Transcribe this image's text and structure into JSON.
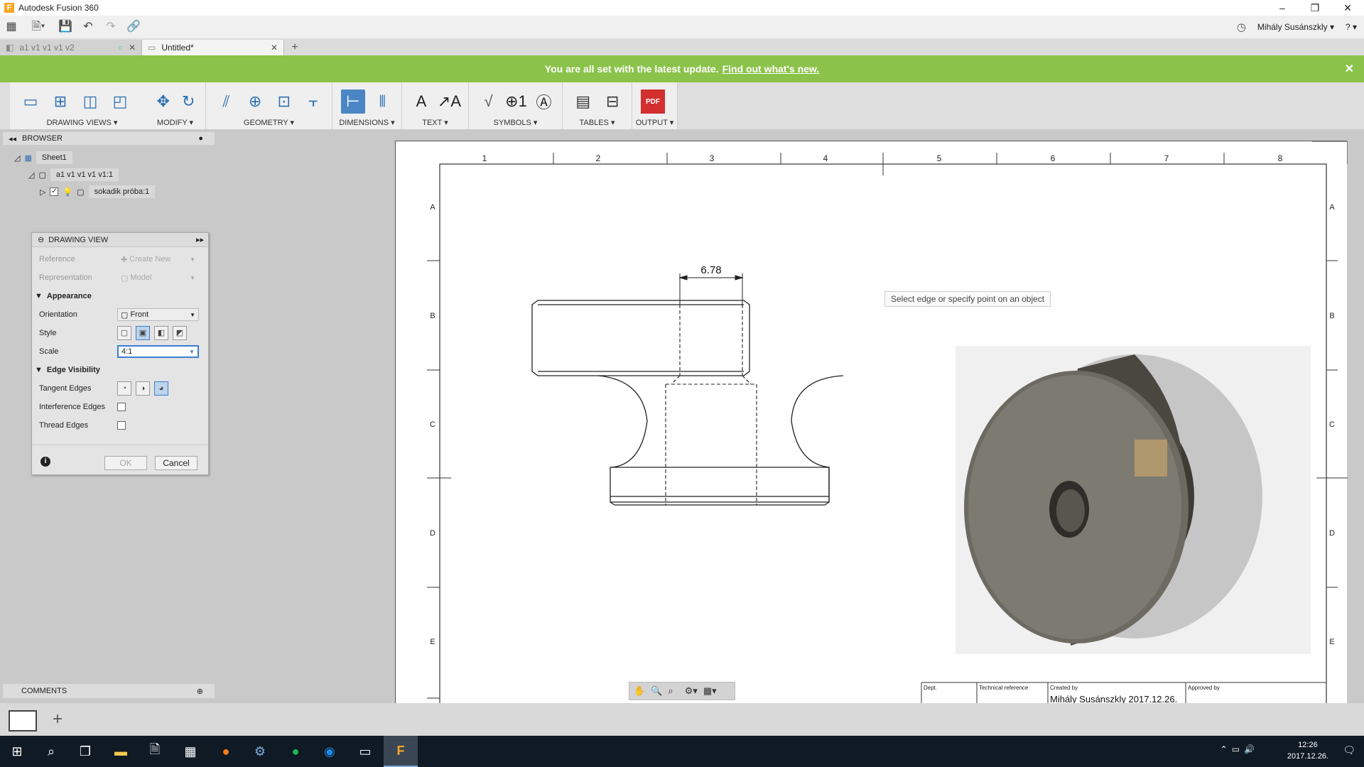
{
  "window": {
    "title": "Autodesk Fusion 360",
    "min": "–",
    "restore": "❐",
    "close": "✕"
  },
  "user": {
    "name": "Mihály Susánszkly ▾",
    "help": "? ▾"
  },
  "tabs": [
    {
      "label": "a1 v1 v1 v1 v2"
    },
    {
      "label": "Untitled*"
    }
  ],
  "banner": {
    "text": "You are all set with the latest update.",
    "link": "Find out what's new."
  },
  "ribbon": {
    "groups": [
      "DRAWING VIEWS ▾",
      "MODIFY ▾",
      "GEOMETRY ▾",
      "DIMENSIONS ▾",
      "TEXT ▾",
      "SYMBOLS ▾",
      "TABLES ▾",
      "OUTPUT ▾"
    ]
  },
  "browser": {
    "title": "BROWSER",
    "sheet": "Sheet1",
    "view": "a1 v1 v1 v1 v1:1",
    "component": "sokadik próba:1"
  },
  "panel": {
    "title": "DRAWING VIEW",
    "reference_label": "Reference",
    "reference_value": "Create New",
    "representation_label": "Representation",
    "representation_value": "Model",
    "appearance": "Appearance",
    "orientation_label": "Orientation",
    "orientation_value": "Front",
    "style_label": "Style",
    "scale_label": "Scale",
    "scale_value": "4:1",
    "edge_visibility": "Edge Visibility",
    "tangent_label": "Tangent Edges",
    "interference_label": "Interference Edges",
    "thread_label": "Thread Edges",
    "ok": "OK",
    "cancel": "Cancel"
  },
  "comments": {
    "label": "COMMENTS"
  },
  "hint": "Select edge or specify point on an object",
  "drawing": {
    "dimension": "6.78",
    "columns": [
      "1",
      "2",
      "3",
      "4",
      "5",
      "6",
      "7",
      "8"
    ],
    "rows": [
      "A",
      "B",
      "C",
      "D",
      "E"
    ],
    "titleblock": {
      "dept": "Dept.",
      "techref": "Technical reference",
      "created_by": "Created by",
      "approved_by": "Approved by",
      "author": "Mihály Susánszkly 2017.12.26."
    }
  },
  "taskbar": {
    "time": "12:26",
    "date": "2017.12.26."
  },
  "colors": {
    "banner": "#8bc34a",
    "accent": "#3b7ed0",
    "taskbar": "#101a24"
  }
}
